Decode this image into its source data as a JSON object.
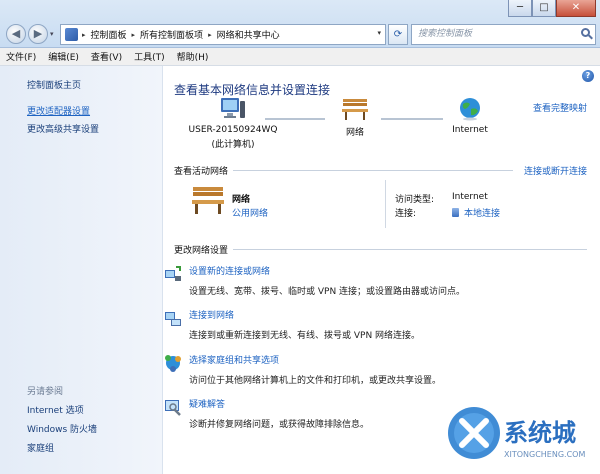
{
  "window": {
    "minimize": "─",
    "maximize": "□",
    "close": "✕"
  },
  "nav": {
    "back": "◀",
    "forward": "▶",
    "dropdown": "▾"
  },
  "address": {
    "crumbs": [
      "控制面板",
      "所有控制面板项",
      "网络和共享中心"
    ],
    "separator": "▸",
    "dropdown": "▾"
  },
  "refresh_glyph": "⟳",
  "search": {
    "placeholder": "搜索控制面板"
  },
  "menubar": [
    "文件(F)",
    "编辑(E)",
    "查看(V)",
    "工具(T)",
    "帮助(H)"
  ],
  "sidebar": {
    "home": "控制面板主页",
    "links": [
      "更改适配器设置",
      "更改高级共享设置"
    ],
    "see_also_title": "另请参阅",
    "see_also": [
      "Internet 选项",
      "Windows 防火墙",
      "家庭组"
    ]
  },
  "main": {
    "title": "查看基本网络信息并设置连接",
    "see_full_map": "查看完整映射",
    "nodes": [
      {
        "label": "USER-20150924WQ",
        "sublabel": "(此计算机)",
        "icon": "computer-icon"
      },
      {
        "label": "网络",
        "icon": "bench-icon"
      },
      {
        "label": "Internet",
        "icon": "globe-icon"
      }
    ],
    "active_section": {
      "title": "查看活动网络",
      "link": "连接或断开连接",
      "network_name": "网络",
      "network_type": "公用网络",
      "access_type_label": "访问类型:",
      "access_type_value": "Internet",
      "connection_label": "连接:",
      "connection_value": "本地连接"
    },
    "change_section": {
      "title": "更改网络设置",
      "tasks": [
        {
          "link": "设置新的连接或网络",
          "desc": "设置无线、宽带、拨号、临时或 VPN 连接；或设置路由器或访问点。",
          "icon": "new-connection-icon"
        },
        {
          "link": "连接到网络",
          "desc": "连接到或重新连接到无线、有线、拨号或 VPN 网络连接。",
          "icon": "connect-network-icon"
        },
        {
          "link": "选择家庭组和共享选项",
          "desc": "访问位于其他网络计算机上的文件和打印机，或更改共享设置。",
          "icon": "homegroup-icon"
        },
        {
          "link": "疑难解答",
          "desc": "诊断并修复网络问题，或获得故障排除信息。",
          "icon": "troubleshoot-icon"
        }
      ]
    }
  },
  "watermark": {
    "text": "系统城",
    "sub": "XITONGCHENG.COM"
  },
  "colors": {
    "link": "#1e63c2",
    "title": "#1e3a80",
    "sidebar_bg": "#e4ecf7"
  }
}
